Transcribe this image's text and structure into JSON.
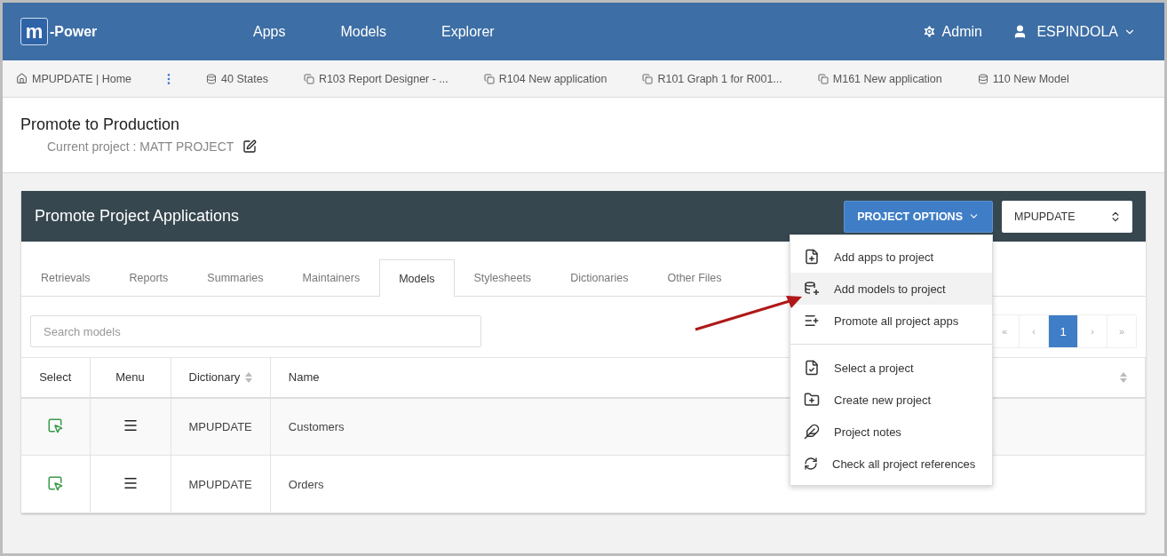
{
  "header": {
    "logo_mark": "m",
    "logo_text": "-Power",
    "nav": [
      "Apps",
      "Models",
      "Explorer"
    ],
    "admin": "Admin",
    "user": "ESPINDOLA"
  },
  "breadcrumbs": [
    {
      "kind": "home",
      "label": "MPUPDATE | Home"
    },
    {
      "kind": "more"
    },
    {
      "kind": "model",
      "label": "40 States"
    },
    {
      "kind": "app",
      "label": "R103 Report Designer - ..."
    },
    {
      "kind": "app",
      "label": "R104 New application"
    },
    {
      "kind": "app",
      "label": "R101 Graph 1 for R001..."
    },
    {
      "kind": "app",
      "label": "M161 New application"
    },
    {
      "kind": "model",
      "label": "110 New Model"
    }
  ],
  "page": {
    "title": "Promote to Production",
    "subtitle": "Current project : MATT PROJECT"
  },
  "panel": {
    "title": "Promote Project Applications",
    "options_button": "PROJECT OPTIONS",
    "dictionary_select": "MPUPDATE",
    "tabs": [
      {
        "label": "Retrievals",
        "selected": false
      },
      {
        "label": "Reports",
        "selected": false
      },
      {
        "label": "Summaries",
        "selected": false
      },
      {
        "label": "Maintainers",
        "selected": false
      },
      {
        "label": "Models",
        "selected": true
      },
      {
        "label": "Stylesheets",
        "selected": false
      },
      {
        "label": "Dictionaries",
        "selected": false
      },
      {
        "label": "Other Files",
        "selected": false
      }
    ],
    "search": {
      "placeholder": "Search models"
    },
    "pagination": [
      {
        "label": "«",
        "selected": false
      },
      {
        "label": "‹",
        "selected": false
      },
      {
        "label": "1",
        "selected": true
      },
      {
        "label": "›",
        "selected": false
      },
      {
        "label": "»",
        "selected": false
      }
    ],
    "table": {
      "columns": [
        {
          "label": "Select",
          "sortable": false
        },
        {
          "label": "Menu",
          "sortable": false
        },
        {
          "label": "Dictionary",
          "sortable": true
        },
        {
          "label": "Name",
          "sortable": true
        }
      ],
      "rows": [
        {
          "dictionary": "MPUPDATE",
          "name": "Customers"
        },
        {
          "dictionary": "MPUPDATE",
          "name": "Orders"
        }
      ]
    }
  },
  "options_menu": {
    "sections": [
      [
        {
          "label": "Add apps to project",
          "selected": false
        },
        {
          "label": "Add models to project",
          "selected": true
        },
        {
          "label": "Promote all project apps",
          "selected": false
        }
      ],
      [
        {
          "label": "Select a project",
          "selected": false
        },
        {
          "label": "Create new project",
          "selected": false
        },
        {
          "label": "Project notes",
          "selected": false
        },
        {
          "label": "Check all project references",
          "selected": false
        }
      ]
    ]
  }
}
